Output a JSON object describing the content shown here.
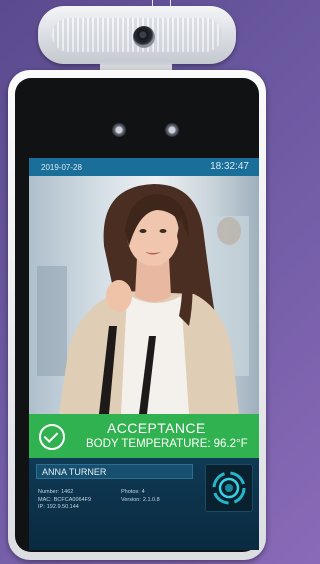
{
  "status_bar": {
    "date": "2019-07-28",
    "time": "18:32:47"
  },
  "result": {
    "status": "ACCEPTANCE",
    "temperature_label": "BODY TEMPERATURE:",
    "temperature_value": "96.2°F",
    "status_color": "#2fb24f"
  },
  "person": {
    "name": "ANNA TURNER",
    "number_label": "Number:",
    "number": "1462",
    "mac_label": "MAC:",
    "mac": "BCFCA0064F9",
    "ip_label": "IP:",
    "ip": "192.9.50.144",
    "photos_label": "Photos:",
    "photos": "4",
    "version_label": "Version:",
    "version": "2.1.0.8"
  },
  "icons": [
    "check-circle-icon",
    "face-scan-icon",
    "camera-lens-icon"
  ]
}
